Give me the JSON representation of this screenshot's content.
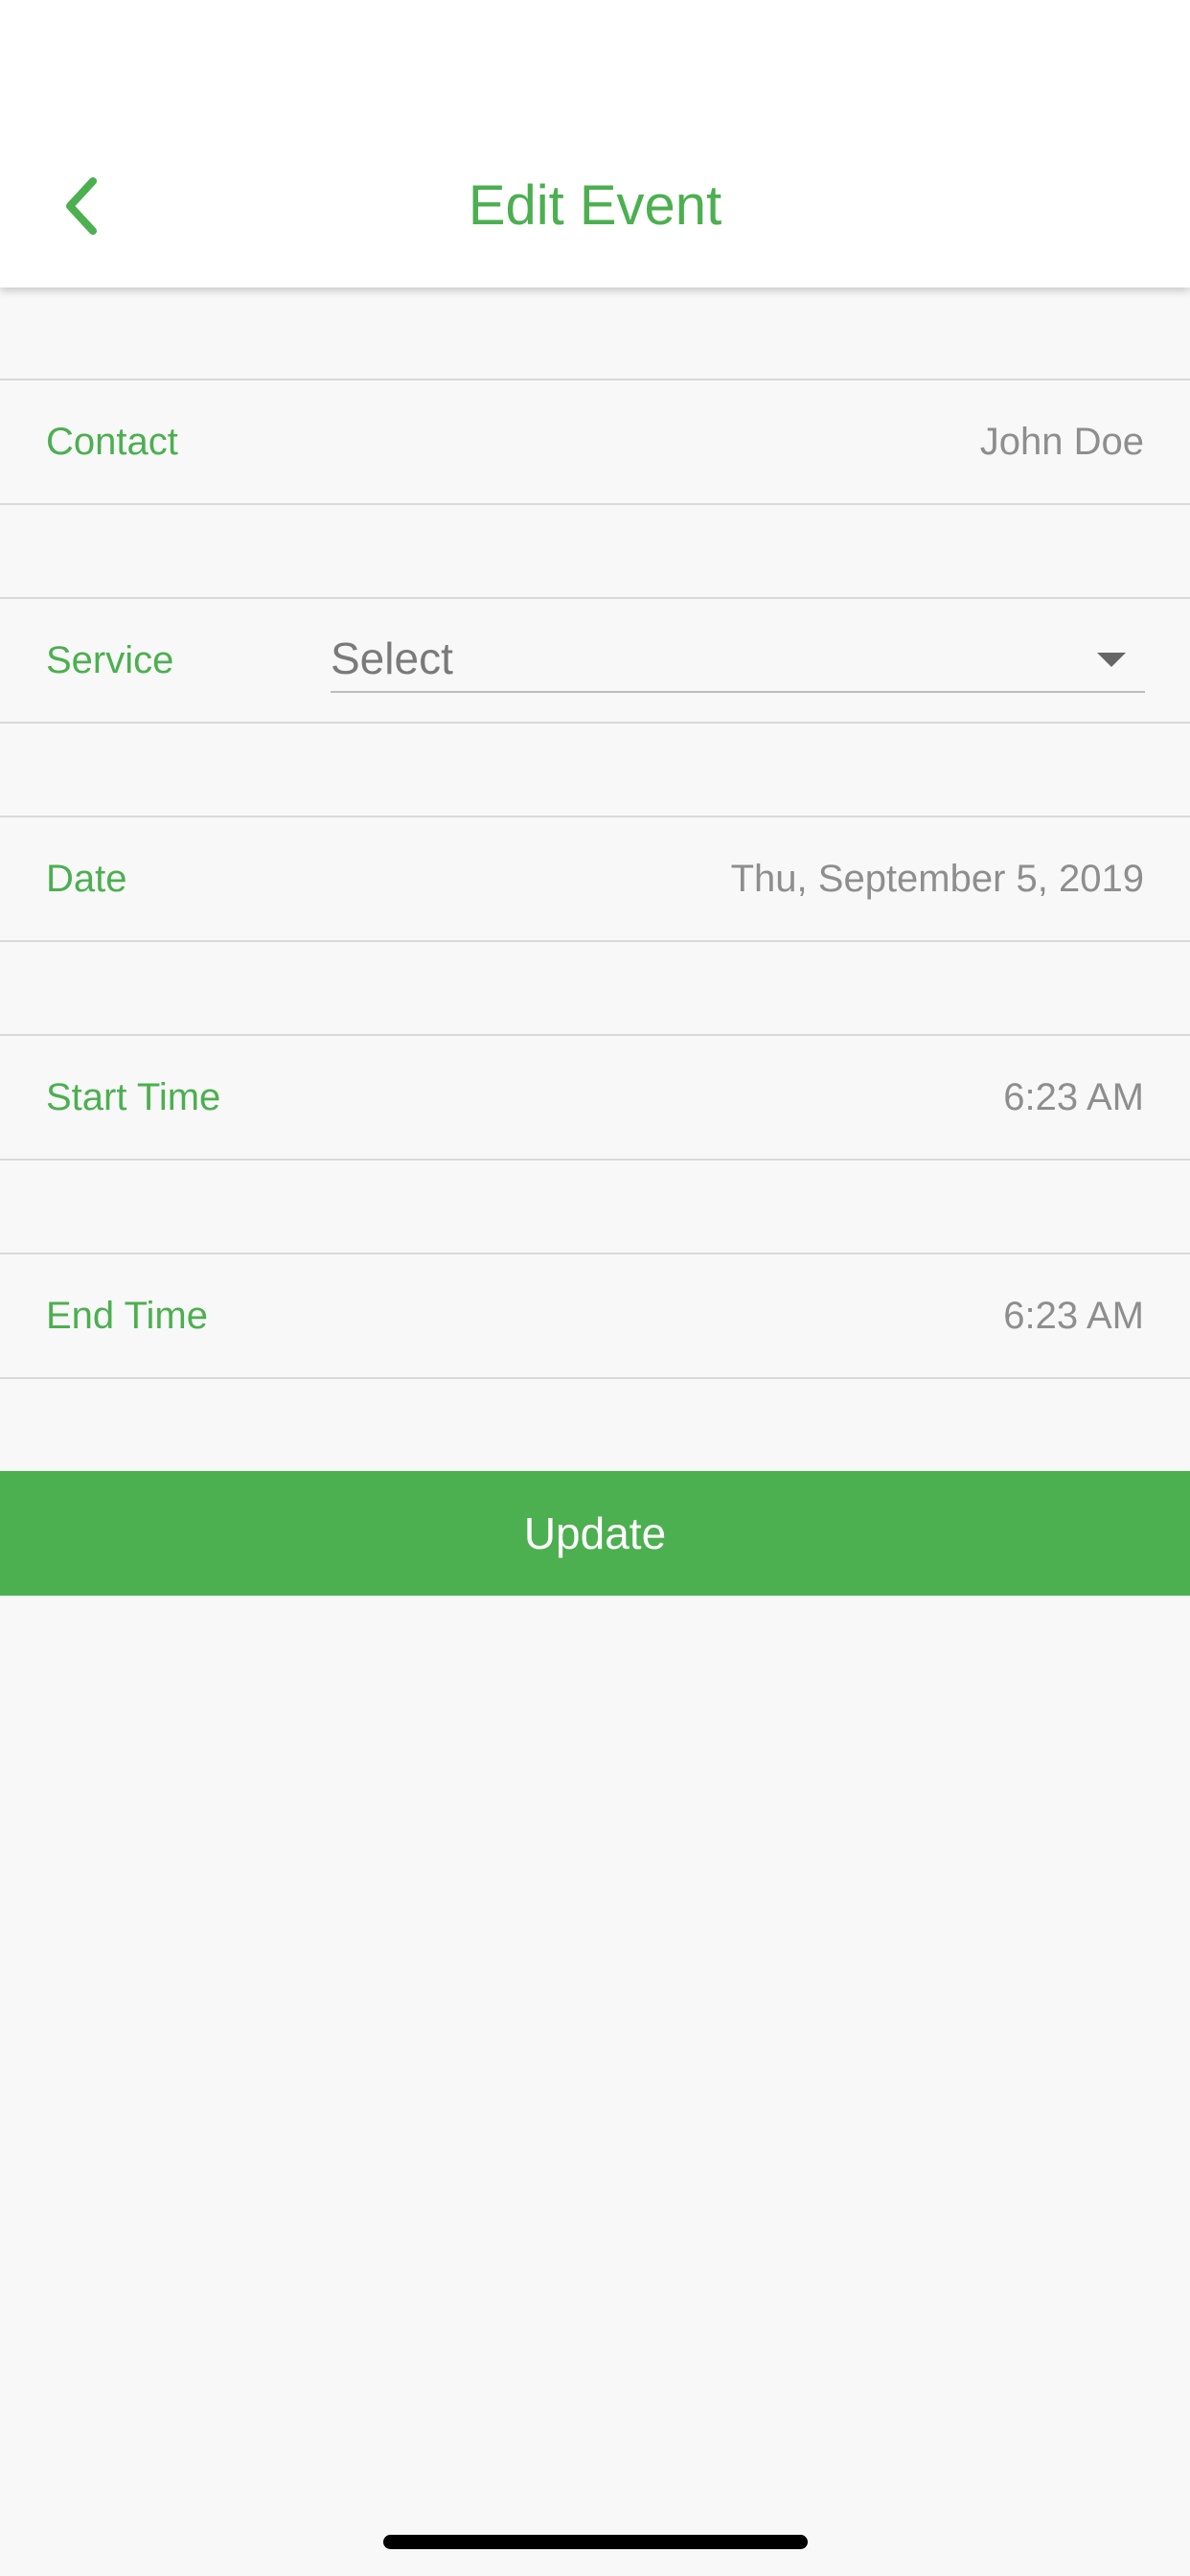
{
  "header": {
    "title": "Edit Event",
    "back_icon": "chevron-left-icon"
  },
  "form": {
    "contact": {
      "label": "Contact",
      "value": "John Doe"
    },
    "service": {
      "label": "Service",
      "value": "Select",
      "icon": "dropdown-arrow-icon"
    },
    "date": {
      "label": "Date",
      "value": "Thu, September 5, 2019"
    },
    "start_time": {
      "label": "Start Time",
      "value": "6:23 AM"
    },
    "end_time": {
      "label": "End Time",
      "value": "6:23 AM"
    }
  },
  "actions": {
    "update_label": "Update"
  },
  "colors": {
    "accent": "#4caf50",
    "background": "#f8f8f8",
    "value_text": "#8e8e8e"
  }
}
